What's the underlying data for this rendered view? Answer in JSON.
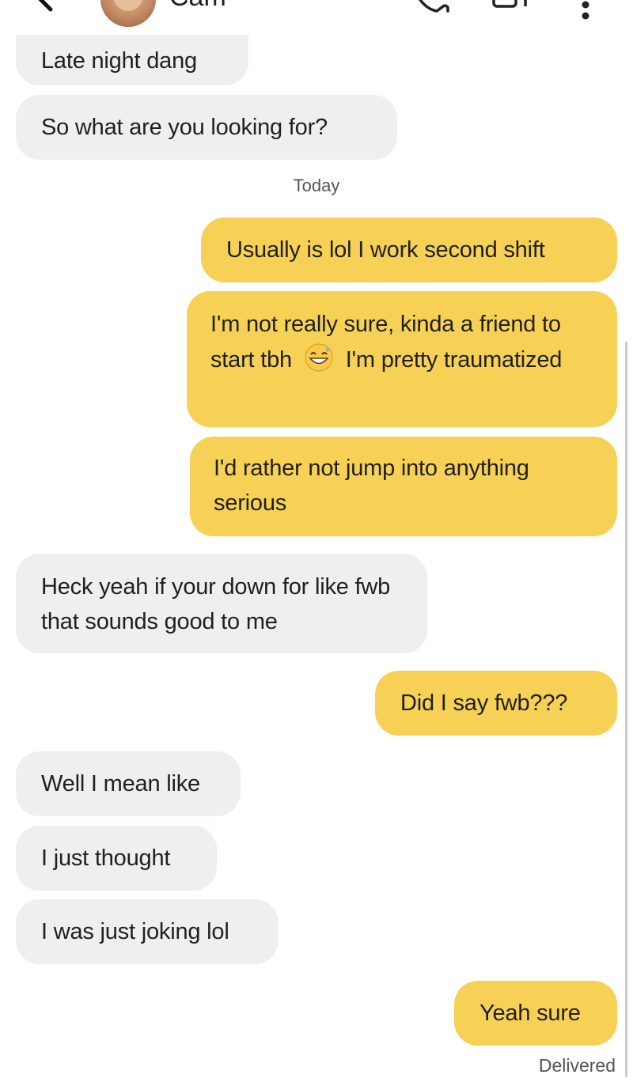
{
  "header": {
    "contact_name": "Cam",
    "icons": {
      "back": "back-arrow-icon",
      "phone": "phone-icon",
      "video": "video-icon",
      "more": "more-vertical-icon"
    }
  },
  "colors": {
    "incoming_bubble": "#efefef",
    "outgoing_bubble": "#f7d155",
    "background": "#ffffff"
  },
  "messages": {
    "m1": "Late night dang",
    "m2": "So what are you looking for?",
    "date_separator": "Today",
    "m3": "Usually is lol I work second shift",
    "m4_part1": "I'm not really sure, kinda a friend to start tbh",
    "m4_emoji": "grinning-sweat-emoji",
    "m4_part2": "I'm pretty traumatized",
    "m5": "I'd rather not jump into anything serious",
    "m6": "Heck yeah if your down for like fwb that sounds good to me",
    "m7": "Did I say fwb???",
    "m8": "Well I mean like",
    "m9": "I just thought",
    "m10": "I was just joking lol",
    "m11": "Yeah sure",
    "status": "Delivered"
  }
}
